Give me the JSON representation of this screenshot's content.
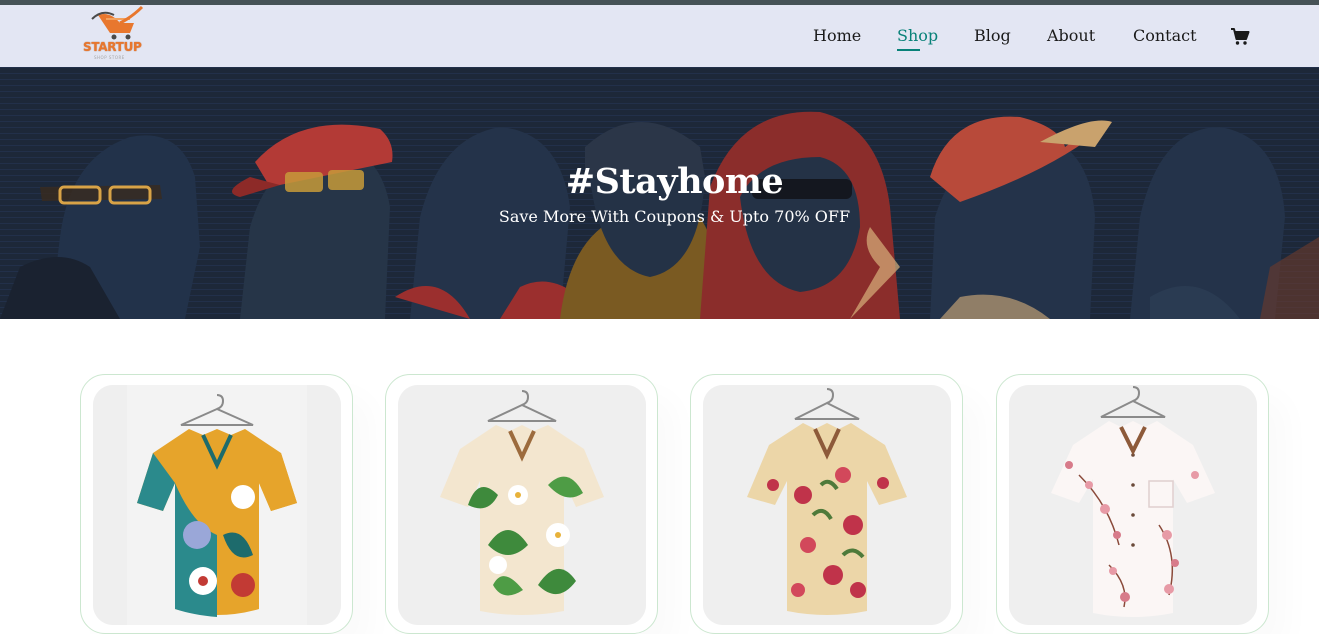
{
  "header": {
    "logo_text": "STARTUP",
    "logo_sub": "SHOP STORE",
    "nav": [
      {
        "label": "Home",
        "active": false
      },
      {
        "label": "Shop",
        "active": true
      },
      {
        "label": "Blog",
        "active": false
      },
      {
        "label": "About",
        "active": false
      },
      {
        "label": "Contact",
        "active": false
      }
    ],
    "cart_icon": "shopping-cart-icon"
  },
  "hero": {
    "title": "#Stayhome",
    "subtitle": "Save More With Coupons & Upto 70% OFF"
  },
  "products": [
    {
      "image": "multicolor-pattern-shirt"
    },
    {
      "image": "green-floral-shirt"
    },
    {
      "image": "red-floral-shirt"
    },
    {
      "image": "pink-blossom-shirt"
    }
  ],
  "colors": {
    "accent": "#088178",
    "header_bg": "#e3e6f3",
    "card_border": "#cce7d0",
    "hero_bg": "#1c2738"
  }
}
